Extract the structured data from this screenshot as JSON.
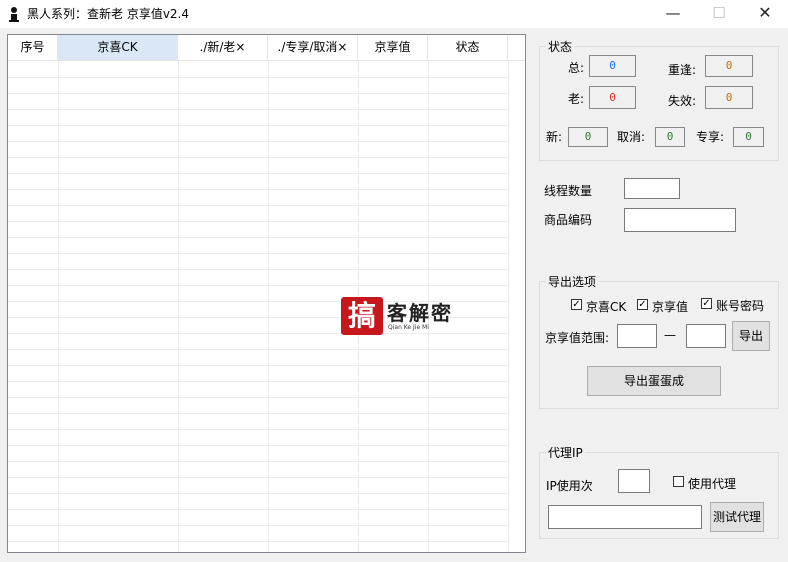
{
  "window": {
    "title": "黑人系列：查新老 京享值v2.4",
    "min_glyph": "—",
    "max_glyph": "☐",
    "close_glyph": "✕"
  },
  "table": {
    "columns": [
      "序号",
      "京喜CK",
      "./新/老×",
      "./专享/取消×",
      "京享值",
      "状态"
    ],
    "selected_column": 1
  },
  "status_group": {
    "title": "状态",
    "total_label": "总:",
    "total_value": "0",
    "repeat_label": "重逢:",
    "repeat_value": "0",
    "old_label": "老:",
    "old_value": "0",
    "fail_label": "失效:",
    "fail_value": "0",
    "new_label": "新:",
    "new_value": "0",
    "cancel_label": "取消:",
    "cancel_value": "0",
    "exclusive_label": "专享:",
    "exclusive_value": "0"
  },
  "settings": {
    "threads_label": "线程数量",
    "threads_value": "",
    "product_code_label": "商品编码",
    "product_code_value": ""
  },
  "export_group": {
    "title": "导出选项",
    "options": [
      {
        "label": "京喜CK",
        "checked": true
      },
      {
        "label": "京享值",
        "checked": true
      },
      {
        "label": "账号密码",
        "checked": true
      }
    ],
    "range_label": "京享值范围:",
    "range_from": "",
    "range_dash": "—",
    "range_to": "",
    "export_button": "导出",
    "export_egg_button": "导出蛋蛋成"
  },
  "proxy_group": {
    "title": "代理IP",
    "ip_uses_label": "IP使用次",
    "ip_uses_value": "",
    "use_proxy_label": "使用代理",
    "use_proxy_checked": false,
    "proxy_address_value": "",
    "test_proxy_button": "测试代理"
  },
  "watermark": {
    "glyph": "搞",
    "text": "客解密",
    "subtext": "Qian Ke Jie Mi"
  }
}
